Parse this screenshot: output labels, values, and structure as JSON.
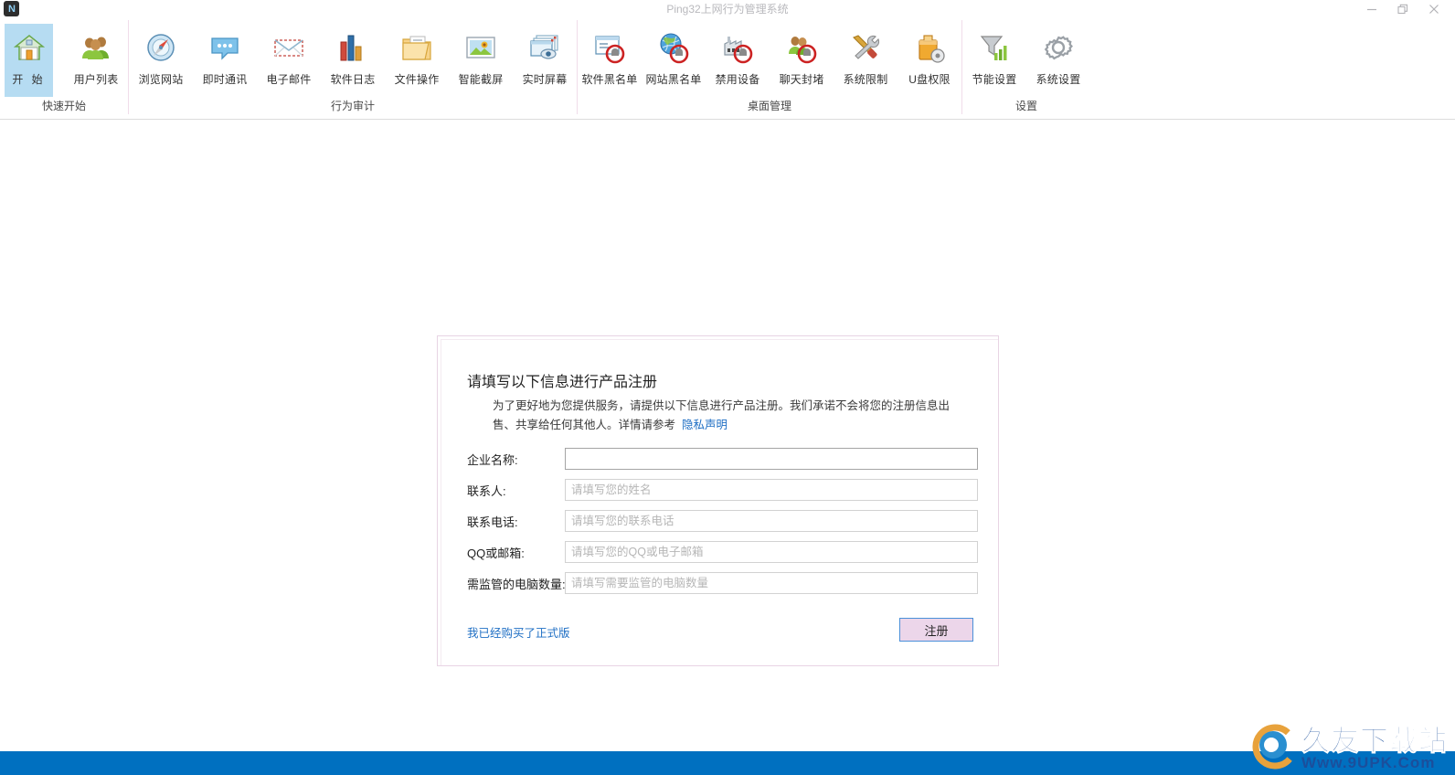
{
  "window": {
    "title": "Ping32上网行为管理系统",
    "logo_text": "N",
    "controls": {
      "minimize": "minimize-button",
      "restore": "restore-button",
      "close": "close-button"
    }
  },
  "ribbon": {
    "groups": [
      {
        "label": "快速开始",
        "items": [
          {
            "label": "开 始",
            "icon": "home-icon",
            "selected": true
          },
          {
            "label": "用户列表",
            "icon": "users-icon",
            "selected": false
          }
        ]
      },
      {
        "label": "行为审计",
        "items": [
          {
            "label": "浏览网站",
            "icon": "compass-icon",
            "selected": false
          },
          {
            "label": "即时通讯",
            "icon": "chat-bubble-icon",
            "selected": false
          },
          {
            "label": "电子邮件",
            "icon": "envelope-icon",
            "selected": false
          },
          {
            "label": "软件日志",
            "icon": "bar-chart-icon",
            "selected": false
          },
          {
            "label": "文件操作",
            "icon": "folder-document-icon",
            "selected": false
          },
          {
            "label": "智能截屏",
            "icon": "picture-icon",
            "selected": false
          },
          {
            "label": "实时屏幕",
            "icon": "screen-eye-icon",
            "selected": false
          }
        ]
      },
      {
        "label": "桌面管理",
        "items": [
          {
            "label": "软件黑名单",
            "icon": "window-block-icon",
            "selected": false
          },
          {
            "label": "网站黑名单",
            "icon": "globe-block-icon",
            "selected": false
          },
          {
            "label": "禁用设备",
            "icon": "device-block-icon",
            "selected": false
          },
          {
            "label": "聊天封堵",
            "icon": "users-block-icon",
            "selected": false
          },
          {
            "label": "系统限制",
            "icon": "tools-icon",
            "selected": false
          },
          {
            "label": "U盘权限",
            "icon": "usb-lock-icon",
            "selected": false
          }
        ]
      },
      {
        "label": "设置",
        "items": [
          {
            "label": "节能设置",
            "icon": "funnel-chart-icon",
            "selected": false
          },
          {
            "label": "系统设置",
            "icon": "gear-icon",
            "selected": false
          }
        ]
      }
    ]
  },
  "dialog": {
    "title": "请填写以下信息进行产品注册",
    "description": "为了更好地为您提供服务，请提供以下信息进行产品注册。我们承诺不会将您的注册信息出售、共享给任何其他人。详情请参考",
    "privacy_link": "隐私声明",
    "fields": [
      {
        "label": "企业名称:",
        "value": "",
        "placeholder": "",
        "focused": true
      },
      {
        "label": "联系人:",
        "value": "",
        "placeholder": "请填写您的姓名",
        "focused": false
      },
      {
        "label": "联系电话:",
        "value": "",
        "placeholder": "请填写您的联系电话",
        "focused": false
      },
      {
        "label": "QQ或邮箱:",
        "value": "",
        "placeholder": "请填写您的QQ或电子邮箱",
        "focused": false
      },
      {
        "label": "需监管的电脑数量:",
        "value": "",
        "placeholder": "请填写需要监管的电脑数量",
        "focused": false
      }
    ],
    "purchased_link": "我已经购买了正式版",
    "register_button": "注册"
  },
  "watermark": {
    "main": "久友下载站",
    "sub": "Www.9UPK.Com"
  },
  "colors": {
    "accent_blue": "#0070c0",
    "selected_item": "#b6dcf2",
    "link": "#1f6fc4",
    "button_fill": "#ecd6ea",
    "button_border": "#4a90d9",
    "separator": "#f0dcea"
  }
}
